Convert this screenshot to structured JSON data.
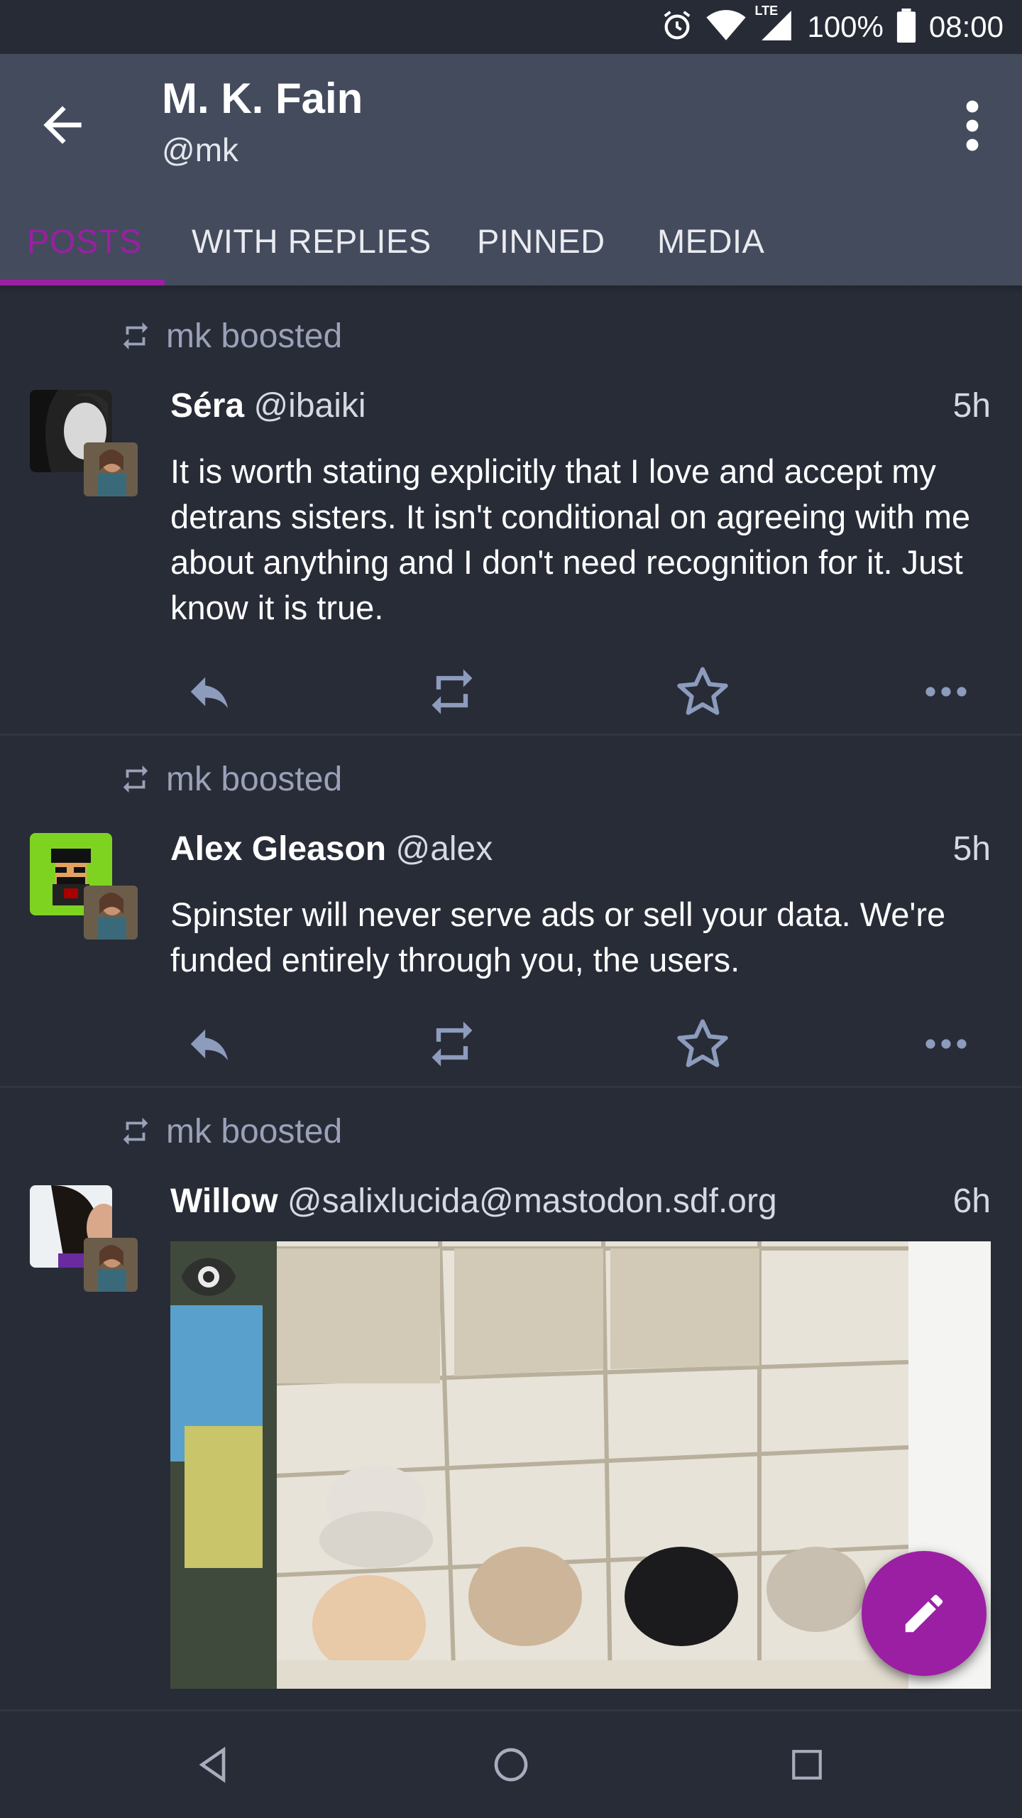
{
  "status_bar": {
    "battery_text": "100%",
    "clock": "08:00",
    "network": "LTE",
    "icons": [
      "alarm-icon",
      "wifi-icon",
      "cell-signal-icon",
      "battery-icon"
    ]
  },
  "app_bar": {
    "title": "M. K. Fain",
    "handle": "@mk",
    "back_icon": "arrow-left-icon",
    "menu_icon": "more-vert-icon"
  },
  "tabs": [
    {
      "label": "POSTS",
      "active": true
    },
    {
      "label": "WITH REPLIES",
      "active": false
    },
    {
      "label": "PINNED",
      "active": false
    },
    {
      "label": "MEDIA",
      "active": false
    }
  ],
  "colors": {
    "accent": "#9b1fa3",
    "background": "#282c37",
    "app_bar": "#444b5d",
    "muted_text": "#9aa1b8",
    "action_icon": "#8d9bbd"
  },
  "posts": [
    {
      "boost_label": "mk boosted",
      "display_name": "Séra",
      "acct": "@ibaiki",
      "time": "5h",
      "content": "It is worth stating explicitly that I love and accept my detrans sisters. It isn't conditional on agreeing with me about anything and I don't need recognition for it. Just know it is true."
    },
    {
      "boost_label": "mk boosted",
      "display_name": "Alex Gleason",
      "acct": "@alex",
      "time": "5h",
      "content": "Spinster will never serve ads or sell your data. We're funded entirely through you, the users."
    },
    {
      "boost_label": "mk boosted",
      "display_name": "Willow",
      "acct": "@salixlucida@mastodon.sdf.org",
      "time": "6h",
      "content": "",
      "media": "photo of kittens in a hanging fabric shoe organizer",
      "media_icon": "eye-icon"
    }
  ],
  "fab": {
    "icon": "pencil-icon"
  },
  "nav_bar": {
    "icons": [
      "back-triangle-icon",
      "home-circle-icon",
      "recents-square-icon"
    ]
  }
}
